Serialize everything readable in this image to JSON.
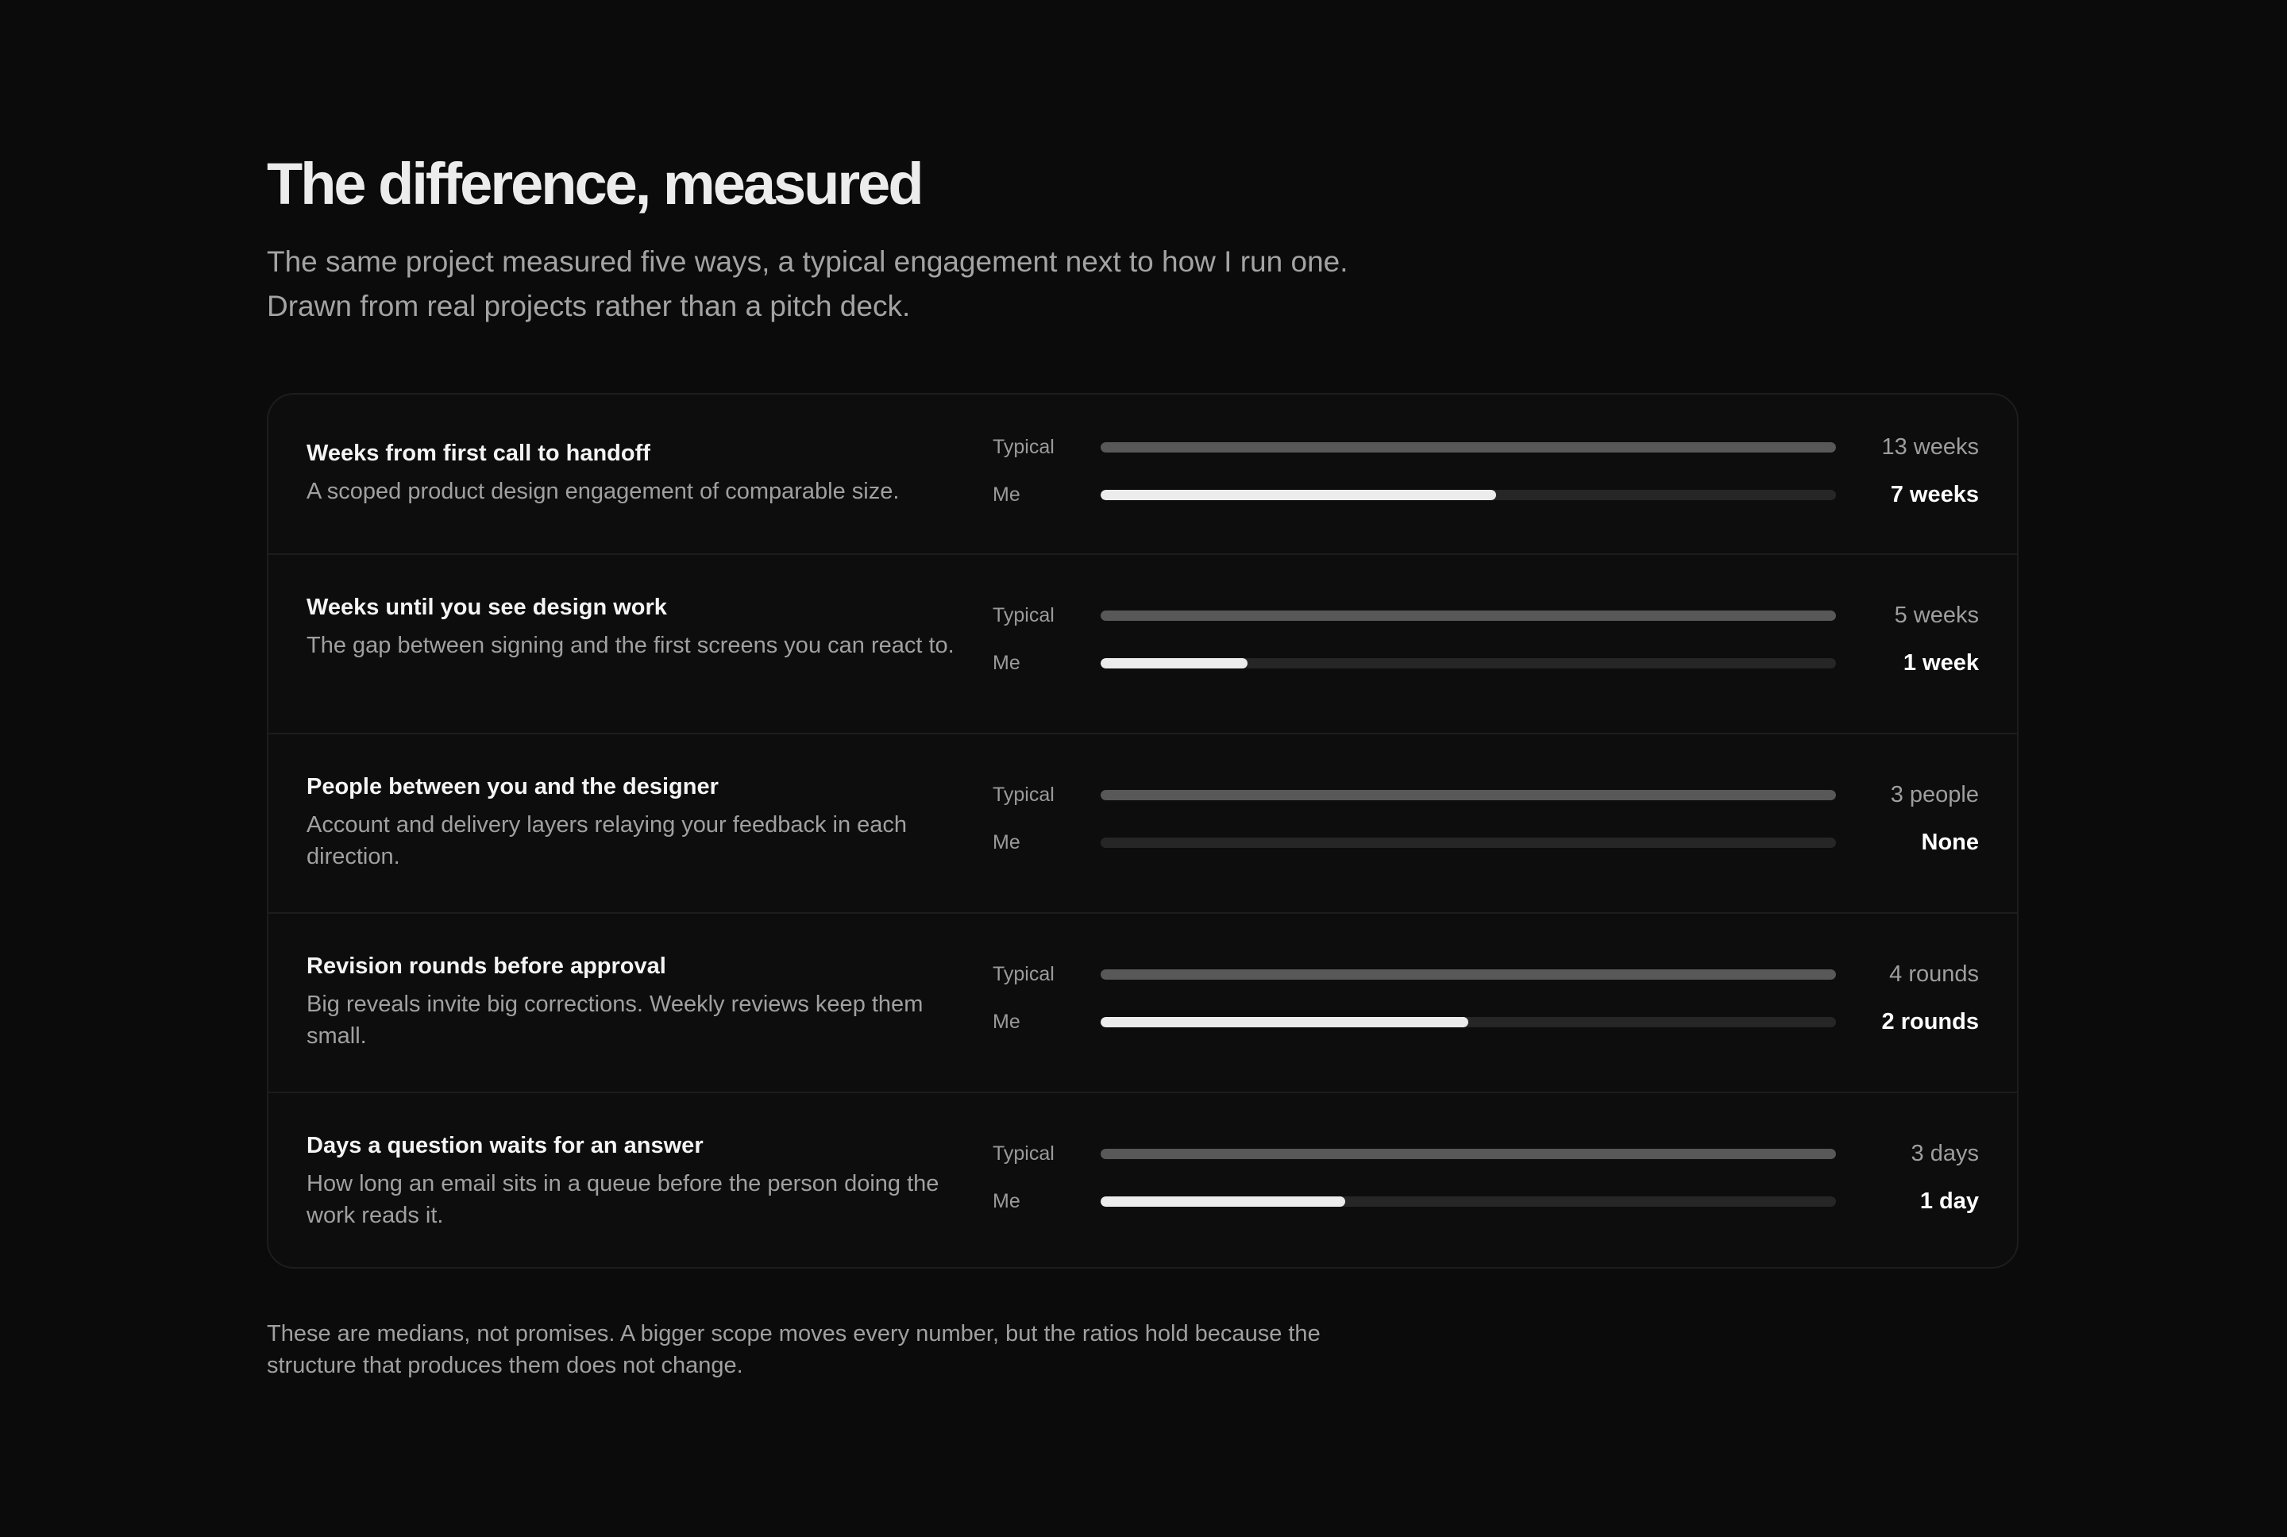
{
  "header": {
    "title": "The difference, measured",
    "subtitle": "The same project measured five ways, a typical engagement next to how I run one. Drawn from real projects rather than a pitch deck."
  },
  "comparison": {
    "typical_label": "Typical",
    "me_label": "Me",
    "rows": [
      {
        "title": "Weeks from first call to handoff",
        "description": "A scoped product design engagement of comparable size.",
        "typical_value": "13 weeks",
        "me_value": "7 weeks",
        "typical_fill": 1.0,
        "me_fill": 0.538
      },
      {
        "title": "Weeks until you see design work",
        "description": "The gap between signing and the first screens you can react to.",
        "typical_value": "5 weeks",
        "me_value": "1 week",
        "typical_fill": 1.0,
        "me_fill": 0.2
      },
      {
        "title": "People between you and the designer",
        "description": "Account and delivery layers relaying your feedback in each direction.",
        "typical_value": "3 people",
        "me_value": "None",
        "typical_fill": 1.0,
        "me_fill": 0
      },
      {
        "title": "Revision rounds before approval",
        "description": "Big reveals invite big corrections. Weekly reviews keep them small.",
        "typical_value": "4 rounds",
        "me_value": "2 rounds",
        "typical_fill": 1.0,
        "me_fill": 0.5
      },
      {
        "title": "Days a question waits for an answer",
        "description": "How long an email sits in a queue before the person doing the work reads it.",
        "typical_value": "3 days",
        "me_value": "1 day",
        "typical_fill": 1.0,
        "me_fill": 0.333
      }
    ]
  },
  "footnote": "These are medians, not promises. A bigger scope moves every number, but the ratios hold because the structure that produces them does not change.",
  "colors": {
    "background": "#0b0b0b",
    "typical_bar": "#585858",
    "me_bar": "#ececec",
    "track": "#262626"
  }
}
